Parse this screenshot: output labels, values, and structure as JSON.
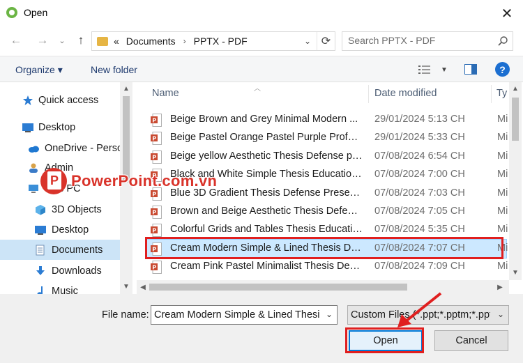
{
  "window": {
    "title": "Open",
    "close_label": "✕"
  },
  "address": {
    "overflow": "«",
    "crumbs": [
      "Documents",
      "PPTX - PDF"
    ],
    "separator": "›"
  },
  "search": {
    "placeholder": "Search PPTX - PDF"
  },
  "toolbar": {
    "organize": "Organize ▾",
    "new_folder": "New folder",
    "help": "?"
  },
  "nav": {
    "items": [
      {
        "label": "Quick access",
        "icon": "star-icon"
      },
      {
        "label": "Desktop",
        "icon": "desktop-icon"
      },
      {
        "label": "OneDrive - Perso",
        "icon": "cloud-icon"
      },
      {
        "label": "Admin",
        "icon": "user-icon"
      },
      {
        "label": "This PC",
        "icon": "computer-icon"
      },
      {
        "label": "3D Objects",
        "icon": "cube-icon"
      },
      {
        "label": "Desktop",
        "icon": "desktop-icon"
      },
      {
        "label": "Documents",
        "icon": "documents-icon"
      },
      {
        "label": "Downloads",
        "icon": "download-icon"
      },
      {
        "label": "Music",
        "icon": "music-icon"
      }
    ]
  },
  "files": {
    "columns": {
      "name": "Name",
      "date": "Date modified",
      "type": "Ty"
    },
    "rows": [
      {
        "name": "Beige Brown and Grey Minimal Modern ...",
        "date": "29/01/2024 5:13 CH",
        "type": "Mi"
      },
      {
        "name": "Beige Pastel Orange Pastel Purple Profess...",
        "date": "29/01/2024 5:33 CH",
        "type": "Mi"
      },
      {
        "name": "Beige yellow Aesthetic Thesis Defense pr...",
        "date": "07/08/2024 6:54 CH",
        "type": "Mi"
      },
      {
        "name": "Black and White Simple Thesis Education...",
        "date": "07/08/2024 7:00 CH",
        "type": "Mi"
      },
      {
        "name": "Blue 3D Gradient Thesis Defense Present...",
        "date": "07/08/2024 7:03 CH",
        "type": "Mi"
      },
      {
        "name": "Brown and Beige Aesthetic Thesis Defens...",
        "date": "07/08/2024 7:05 CH",
        "type": "Mi"
      },
      {
        "name": "Colorful Grids and Tables Thesis Educatio...",
        "date": "07/08/2024 5:35 CH",
        "type": "Mi"
      },
      {
        "name": "Cream Modern Simple & Lined Thesis De...",
        "date": "07/08/2024 7:07 CH",
        "type": "Mi"
      },
      {
        "name": "Cream Pink Pastel Minimalist Thesis Defe...",
        "date": "07/08/2024 7:09 CH",
        "type": "Mi"
      }
    ]
  },
  "footer": {
    "file_name_label": "File name:",
    "file_name_value": "Cream Modern Simple & Lined Thesi",
    "file_type_value": "Custom Files (*.ppt;*.pptm;*.ppt",
    "open": "Open",
    "cancel": "Cancel"
  },
  "watermark": {
    "text": "PowerPoint.com.vn",
    "letter": "P"
  },
  "colors": {
    "accent": "#0078d7",
    "highlight": "#e01f1f",
    "selection": "#cce8ff"
  }
}
